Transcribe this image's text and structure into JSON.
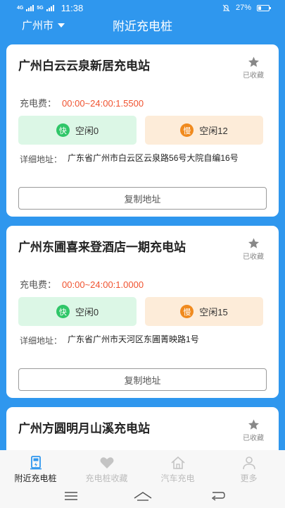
{
  "status_bar": {
    "network": "4G",
    "network2": "5G",
    "time": "11:38",
    "battery_pct": "27%",
    "battery_level": 0.27
  },
  "header": {
    "city": "广州市",
    "title": "附近充电桩"
  },
  "stations": [
    {
      "name": "广州白云云泉新居充电站",
      "fav_label": "已收藏",
      "fee_label": "充电费：",
      "fee": "00:00~24:00:1.5500",
      "fast_badge": "快",
      "fast_text": "空闲0",
      "slow_badge": "慢",
      "slow_text": "空闲12",
      "addr_label": "详细地址：",
      "address": "广东省广州市白云区云泉路56号大院自编16号",
      "copy_label": "复制地址"
    },
    {
      "name": "广州东圃喜来登酒店一期充电站",
      "fav_label": "已收藏",
      "fee_label": "充电费：",
      "fee": "00:00~24:00:1.0000",
      "fast_badge": "快",
      "fast_text": "空闲0",
      "slow_badge": "慢",
      "slow_text": "空闲15",
      "addr_label": "详细地址：",
      "address": "广东省广州市天河区东圃菁映路1号",
      "copy_label": "复制地址"
    },
    {
      "name": "广州方圆明月山溪充电站",
      "fav_label": "已收藏"
    }
  ],
  "tabs": [
    {
      "label": "附近充电桩",
      "icon": "charger-icon",
      "active": true
    },
    {
      "label": "充电桩收藏",
      "icon": "heart-icon",
      "active": false
    },
    {
      "label": "汽车充电",
      "icon": "home-icon",
      "active": false
    },
    {
      "label": "更多",
      "icon": "user-icon",
      "active": false
    }
  ],
  "colors": {
    "primary": "#2f97ee",
    "price": "#f0522f",
    "fast": "#2fc668",
    "slow": "#f08a1e"
  }
}
